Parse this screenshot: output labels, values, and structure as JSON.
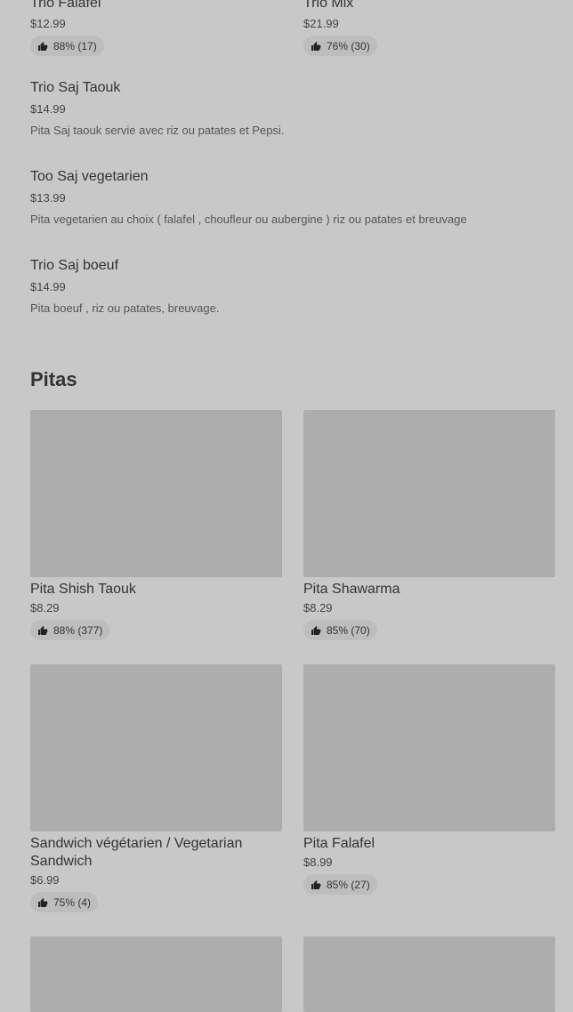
{
  "top_cards": [
    {
      "title": "Trio Falafel",
      "price": "$12.99",
      "rating": "88% (17)"
    },
    {
      "title": "Trio Mix",
      "price": "$21.99",
      "rating": "76% (30)"
    }
  ],
  "list_items": [
    {
      "title": "Trio Saj Taouk",
      "price": "$14.99",
      "desc": "Pita Saj taouk servie avec riz ou patates et Pepsi."
    },
    {
      "title": "Too Saj vegetarien",
      "price": "$13.99",
      "desc": "Pita vegetarien au choix ( falafel , choufleur ou aubergine ) riz ou patates et breuvage"
    },
    {
      "title": "Trio Saj boeuf",
      "price": "$14.99",
      "desc": "Pita boeuf , riz ou patates, breuvage."
    }
  ],
  "section": {
    "title": "Pitas"
  },
  "pitas": [
    {
      "title": "Pita Shish Taouk",
      "price": "$8.29",
      "rating": "88% (377)"
    },
    {
      "title": "Pita Shawarma",
      "price": "$8.29",
      "rating": "85% (70)"
    },
    {
      "title": "Sandwich végétarien / Vegetarian Sandwich",
      "price": "$6.99",
      "rating": "75% (4)"
    },
    {
      "title": "Pita Falafel",
      "price": "$8.99",
      "rating": "85% (27)"
    }
  ],
  "icons": {
    "rating": "thumbs-up-icon"
  },
  "colors": {
    "background": "#c8c8c8",
    "image_placeholder": "#adadad",
    "badge": "#bdbdbd"
  }
}
